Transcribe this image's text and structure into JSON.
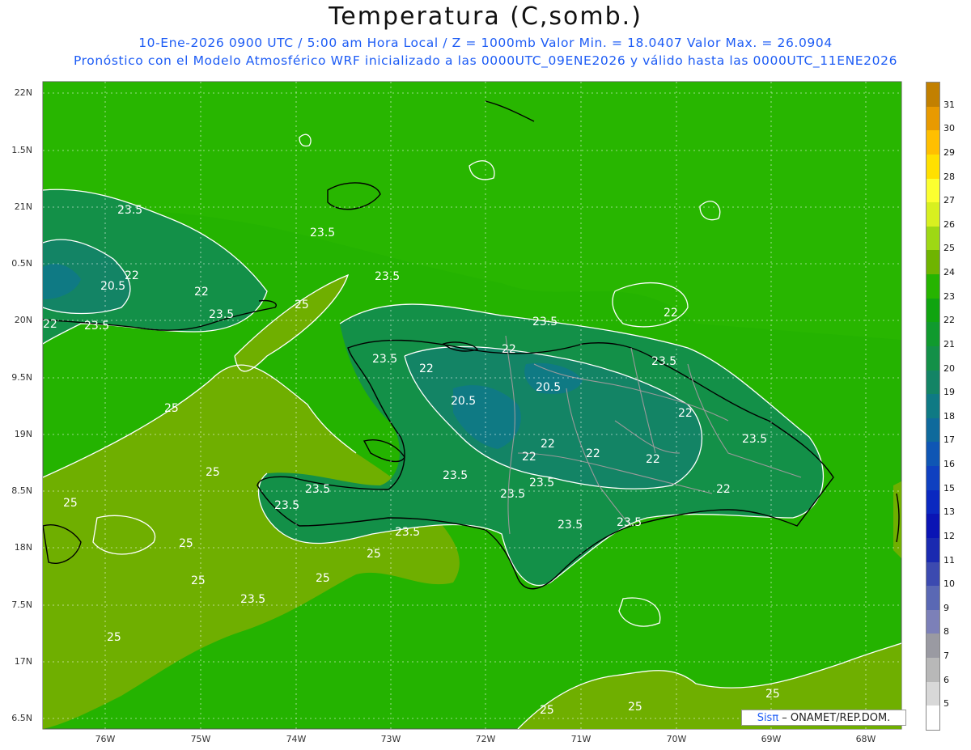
{
  "title": "Temperatura (C,somb.)",
  "subtitle_line1": "10-Ene-2026  0900 UTC / 5:00 am Hora Local / Z = 1000mb    Valor Min. = 18.0407  Valor Max. = 26.0904",
  "subtitle_line2": "Pronóstico con el Modelo Atmosférico WRF inicializado a las 0000UTC_09ENE2026 y válido hasta las  0000UTC_11ENE2026",
  "credit": {
    "logo": "Sisπ",
    "text": " – ONAMET/REP.DOM."
  },
  "lat_labels": [
    "22N",
    "1.5N",
    "21N",
    "0.5N",
    "20N",
    "9.5N",
    "19N",
    "8.5N",
    "18N",
    "7.5N",
    "17N",
    "6.5N"
  ],
  "lon_labels": [
    "76W",
    "75W",
    "74W",
    "73W",
    "72W",
    "71W",
    "70W",
    "69W",
    "68W"
  ],
  "colorbar": {
    "labels": [
      "31",
      "30",
      "29",
      "28",
      "27",
      "26",
      "25",
      "24",
      "23",
      "22",
      "21",
      "20",
      "19",
      "18",
      "17",
      "16",
      "15",
      "13",
      "12",
      "11",
      "10",
      "9",
      "8",
      "7",
      "6",
      "5"
    ],
    "colors": [
      "#c28000",
      "#e89a00",
      "#ffbf00",
      "#ffe000",
      "#fcff30",
      "#d8f020",
      "#9ed814",
      "#6fb400",
      "#26b400",
      "#10a410",
      "#109a2e",
      "#139048",
      "#138465",
      "#0f7a84",
      "#0f6a9c",
      "#0f56b4",
      "#0f40c0",
      "#0a28c0",
      "#0a14b4",
      "#1a2ab0",
      "#3c4ab0",
      "#5a68b4",
      "#7c80b8",
      "#9a9aa2",
      "#b8b8b8",
      "#d8d8d8",
      "#ffffff"
    ]
  },
  "contour_labels": [
    "23.5",
    "23.5",
    "22",
    "20.5",
    "22",
    "23.5",
    "23.5",
    "22",
    "25",
    "23.5",
    "22",
    "22",
    "23.5",
    "20.5",
    "22",
    "23.5",
    "20.5",
    "22",
    "25",
    "22",
    "22",
    "23.5",
    "25",
    "22",
    "23.5",
    "23.5",
    "23.5",
    "22",
    "23.5",
    "23.5",
    "23.5",
    "23.5",
    "22",
    "23.5",
    "23.5",
    "25",
    "25",
    "25",
    "25",
    "25",
    "23.5",
    "25",
    "25",
    "25"
  ],
  "colors": {
    "field_main": "#24b300",
    "field_warm": "#6faf00",
    "field_cool": "#139048",
    "field_cooler": "#138465",
    "field_coolest": "#0f7a84",
    "header_blue": "#1d5cf5"
  }
}
